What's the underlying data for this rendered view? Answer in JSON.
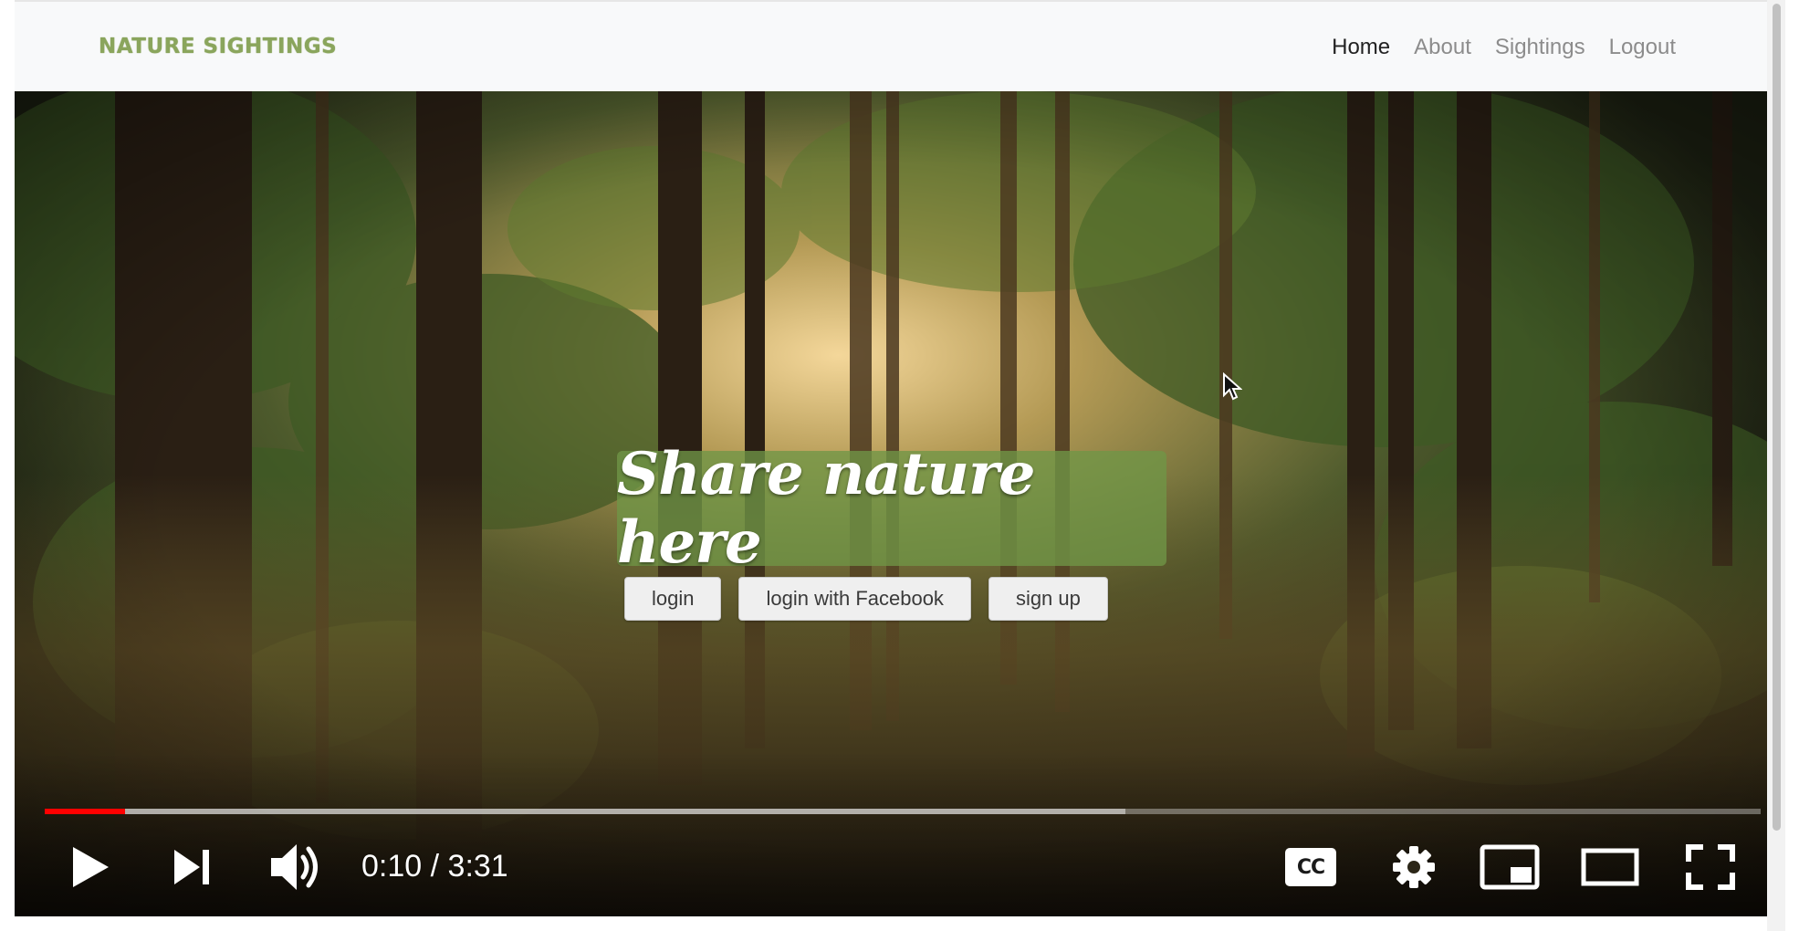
{
  "navbar": {
    "brand": "NATURE SIGHTINGS",
    "links": [
      {
        "label": "Home",
        "active": true
      },
      {
        "label": "About",
        "active": false
      },
      {
        "label": "Sightings",
        "active": false
      },
      {
        "label": "Logout",
        "active": false
      }
    ]
  },
  "hero": {
    "title": "Share nature here",
    "buttons": {
      "login": "login",
      "facebook": "login with Facebook",
      "signup": "sign up"
    }
  },
  "player": {
    "current_time": "0:10",
    "separator": "/",
    "duration": "3:31",
    "progress_fraction": 0.047,
    "buffered_fraction": 0.63,
    "progress_color": "#ff0000",
    "icons": [
      "play-icon",
      "next-icon",
      "volume-icon",
      "captions-icon",
      "settings-icon",
      "miniplayer-icon",
      "theater-mode-icon",
      "fullscreen-icon"
    ],
    "captions_label": "CC"
  },
  "colors": {
    "brand": "#8aa55c",
    "hero_box": "#709646",
    "nav_active": "#222222",
    "nav_inactive": "#8c8c8c"
  }
}
